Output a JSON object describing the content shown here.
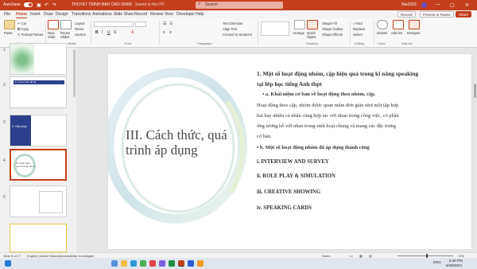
{
  "titlebar": {
    "autosave": "AutoSave",
    "file_name": "THUYET TRINH BAO CAO SKKN",
    "saved_status": "Saved to this PC",
    "search_placeholder": "Search",
    "user": "Nie2203"
  },
  "menu": {
    "tabs": [
      "File",
      "Home",
      "Insert",
      "Draw",
      "Design",
      "Transitions",
      "Animations",
      "Slide Show",
      "Record",
      "Review",
      "View",
      "Developer",
      "Help"
    ],
    "active": "Home",
    "record_btn": "Record",
    "present_btn": "Present in Teams",
    "share_btn": "Share"
  },
  "ribbon": {
    "paste": "Paste",
    "cut": "Cut",
    "copy": "Copy",
    "format_painter": "Format Painter",
    "new_slide": "New Slide",
    "reuse_slides": "Reuse Slides",
    "layout": "Layout",
    "reset": "Reset",
    "section": "Section",
    "text_direction": "Text Direction",
    "align_text": "Align Text",
    "convert_smartart": "Convert to SmartArt",
    "arrange": "Arrange",
    "quick_styles": "Quick Styles",
    "shape_fill": "Shape Fill",
    "shape_outline": "Shape Outline",
    "shape_effects": "Shape Effects",
    "find": "Find",
    "replace": "Replace",
    "select": "Select",
    "dictate": "Dictate",
    "addins": "Add-ins",
    "designer": "Designer",
    "groups": [
      "Clipboard",
      "Slides",
      "Font",
      "Paragraph",
      "Drawing",
      "Editing",
      "Voice",
      "Add-ins"
    ]
  },
  "thumbnails": {
    "numbers": [
      "1",
      "2",
      "3",
      "4",
      "5"
    ],
    "slide2_title": "1. Lý do chọn đề tài",
    "slide3_title": "II. Giải pháp",
    "slide4_title": "III. Cách thức, quá trình áp dụng"
  },
  "slide": {
    "title": "III. Cách thức, quá trình áp dụng",
    "line1": "1.  Một số hoạt động nhóm, cặp hiệu quả trong kĩ năng speaking",
    "line1b": "tại lớp học tiếng Anh thpt",
    "bullet_a": "a.  Khái niệm cơ bản về hoạt động theo nhóm, cặp.",
    "para1": "Hoạt động theo cặp, nhóm được quan niệm đơn giản như một tập hợp",
    "para2": "hai hay nhiều cá nhân cùng hợp tác với nhau trong công việc, có phân",
    "para3": "ứng tương hỗ với nhau trong sinh hoạt chung và mang các đặc trưng",
    "para4": "cơ bản.",
    "bullet_b": "b.  Một số hoạt động nhóm đã áp dụng thành công",
    "item1": "i. INTERVIEW AND SURVEY",
    "item2": "ii. ROLE PLAY & SIMULATION",
    "item3": "iii. CREATIVE SHOWING",
    "item4": "iv. SPEAKING CARDS"
  },
  "status": {
    "slide_of": "Slide 5 of 17",
    "language": "English (United States)",
    "accessibility": "Accessibility: Investigate",
    "notes": "Notes",
    "zoom": "70%"
  },
  "taskbar": {
    "time": "5:40 PM",
    "date": "6/29/2024",
    "lang": "ENG"
  },
  "colors": {
    "brand": "#c43e1c",
    "ribbon_bg": "#f7f7f7"
  }
}
